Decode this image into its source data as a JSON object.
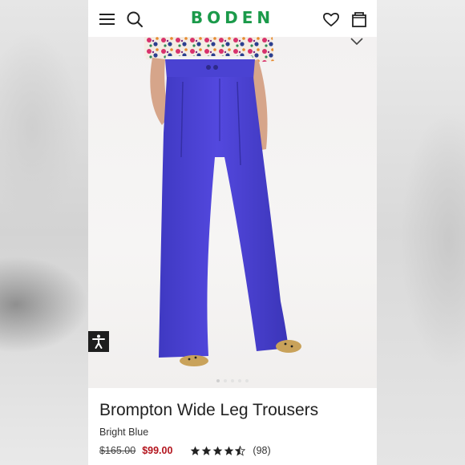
{
  "header": {
    "logo": "BODEN",
    "menu_icon": "hamburger-menu-icon",
    "search_icon": "search-icon",
    "wishlist_icon": "heart-icon",
    "bag_icon": "shopping-bag-icon",
    "brand_color": "#1b9a4a"
  },
  "gallery": {
    "image_count": 5,
    "active_index": 0,
    "expand_icon": "chevron-down-icon",
    "accessibility_icon": "accessibility-person-icon"
  },
  "product": {
    "name": "Brompton Wide Leg Trousers",
    "color_name": "Bright Blue",
    "original_price": "$165.00",
    "sale_price": "$99.00",
    "sale_color": "#b3141d",
    "rating": 4.5,
    "review_count": "(98)"
  }
}
